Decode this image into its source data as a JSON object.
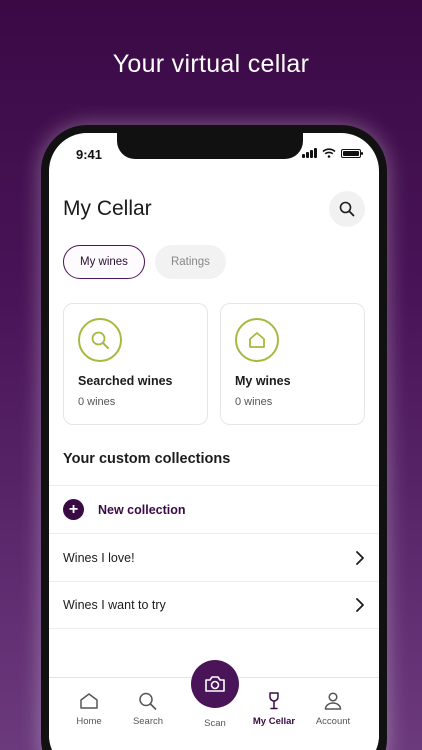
{
  "promo": {
    "headline": "Your virtual cellar"
  },
  "status_bar": {
    "time": "9:41"
  },
  "header": {
    "title": "My Cellar",
    "search_icon": "search-icon"
  },
  "tabs": [
    {
      "label": "My wines",
      "active": true
    },
    {
      "label": "Ratings",
      "active": false
    }
  ],
  "cards": [
    {
      "title": "Searched wines",
      "count": "0 wines",
      "icon": "search-icon"
    },
    {
      "title": "My wines",
      "count": "0 wines",
      "icon": "home-icon"
    }
  ],
  "collections": {
    "title": "Your custom collections",
    "new_label": "New collection",
    "items": [
      {
        "label": "Wines I love!"
      },
      {
        "label": "Wines I want to try"
      }
    ]
  },
  "bottom_nav": {
    "items": [
      {
        "label": "Home",
        "icon": "home-icon"
      },
      {
        "label": "Search",
        "icon": "search-icon"
      },
      {
        "label": "Scan",
        "icon": "camera-icon"
      },
      {
        "label": "My Cellar",
        "icon": "wine-glass-icon",
        "active": true
      },
      {
        "label": "Account",
        "icon": "person-icon"
      }
    ]
  },
  "colors": {
    "brand_purple": "#4a1458",
    "accent_green": "#a8b840",
    "background_dark": "#3a0a45"
  }
}
